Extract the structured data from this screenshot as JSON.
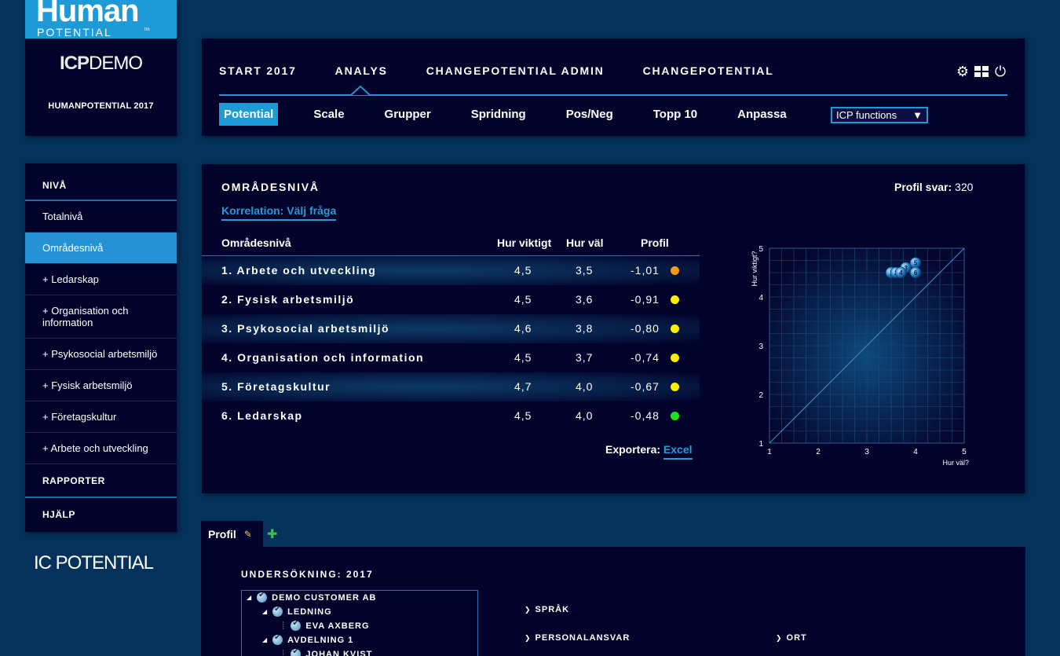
{
  "brand": {
    "logo_word": "Human",
    "logo_sub": "POTENTIAL",
    "logo_tm": "tm",
    "demo_ic": "ICP",
    "demo_text": "DEMO",
    "year_label": "HUMANPOTENTIAL 2017",
    "icp_logo": "IC POTENTIAL"
  },
  "nav": {
    "main": [
      "START 2017",
      "ANALYS",
      "CHANGEPOTENTIAL ADMIN",
      "CHANGEPOTENTIAL"
    ],
    "sub": [
      "Potential",
      "Scale",
      "Grupper",
      "Spridning",
      "Pos/Neg",
      "Topp 10",
      "Anpassa"
    ],
    "active_sub": "Potential",
    "select_value": "ICP functions"
  },
  "sidebar": {
    "header": "NIVÅ",
    "items": [
      "Totalnivå",
      "Områdesnivå",
      "+ Ledarskap",
      "+ Organisation och information",
      "+ Psykosocial arbetsmiljö",
      "+ Fysisk arbetsmiljö",
      "+ Företagskultur",
      "+ Arbete och utveckling"
    ],
    "sections": [
      "RAPPORTER",
      "HJÄLP"
    ]
  },
  "panel": {
    "title": "OMRÅDESNIVÅ",
    "profil_label": "Profil svar:",
    "profil_value": "320",
    "korrelation": "Korrelation: Välj fråga",
    "columns": [
      "Områdesnivå",
      "Hur viktigt",
      "Hur väl",
      "Profil"
    ],
    "rows": [
      {
        "name": "1. Arbete och utveckling",
        "viktigt": "4,5",
        "val": "3,5",
        "profil": "-1,01",
        "color": "#f39a1a"
      },
      {
        "name": "2. Fysisk arbetsmiljö",
        "viktigt": "4,5",
        "val": "3,6",
        "profil": "-0,91",
        "color": "#ffee00"
      },
      {
        "name": "3. Psykosocial arbetsmiljö",
        "viktigt": "4,6",
        "val": "3,8",
        "profil": "-0,80",
        "color": "#ffee00"
      },
      {
        "name": "4. Organisation och information",
        "viktigt": "4,5",
        "val": "3,7",
        "profil": "-0,74",
        "color": "#ffee00"
      },
      {
        "name": "5. Företagskultur",
        "viktigt": "4,7",
        "val": "4,0",
        "profil": "-0,67",
        "color": "#ffee00"
      },
      {
        "name": "6. Ledarskap",
        "viktigt": "4,5",
        "val": "4,0",
        "profil": "-0,48",
        "color": "#22dd22"
      }
    ],
    "export_label": "Exportera:",
    "export_link": "Excel"
  },
  "chart_data": {
    "type": "scatter",
    "xlabel": "Hur väl?",
    "ylabel": "Hur viktigt?",
    "xlim": [
      1,
      5
    ],
    "ylim": [
      1,
      5
    ],
    "ticks": [
      1,
      2,
      3,
      4,
      5
    ],
    "grid": true,
    "diagonal": true,
    "points": [
      {
        "label": "1",
        "x": 3.5,
        "y": 4.5
      },
      {
        "label": "2",
        "x": 3.6,
        "y": 4.5
      },
      {
        "label": "3",
        "x": 3.8,
        "y": 4.6
      },
      {
        "label": "4",
        "x": 3.7,
        "y": 4.5
      },
      {
        "label": "5",
        "x": 4.0,
        "y": 4.7
      },
      {
        "label": "6",
        "x": 4.0,
        "y": 4.5
      }
    ]
  },
  "profile": {
    "tab_label": "Profil",
    "survey_title": "UNDERSÖKNING: 2017",
    "tree": [
      {
        "label": "DEMO CUSTOMER AB",
        "level": 0,
        "expand": "◢"
      },
      {
        "label": "LEDNING",
        "level": 1,
        "expand": "◢"
      },
      {
        "label": "EVA AXBERG",
        "level": 2,
        "expand": ""
      },
      {
        "label": "AVDELNING 1",
        "level": 1,
        "expand": "◢"
      },
      {
        "label": "JOHAN KVIST",
        "level": 2,
        "expand": ""
      }
    ],
    "options": [
      "SPRÅK",
      "PERSONALANSVAR",
      "ORT"
    ]
  }
}
